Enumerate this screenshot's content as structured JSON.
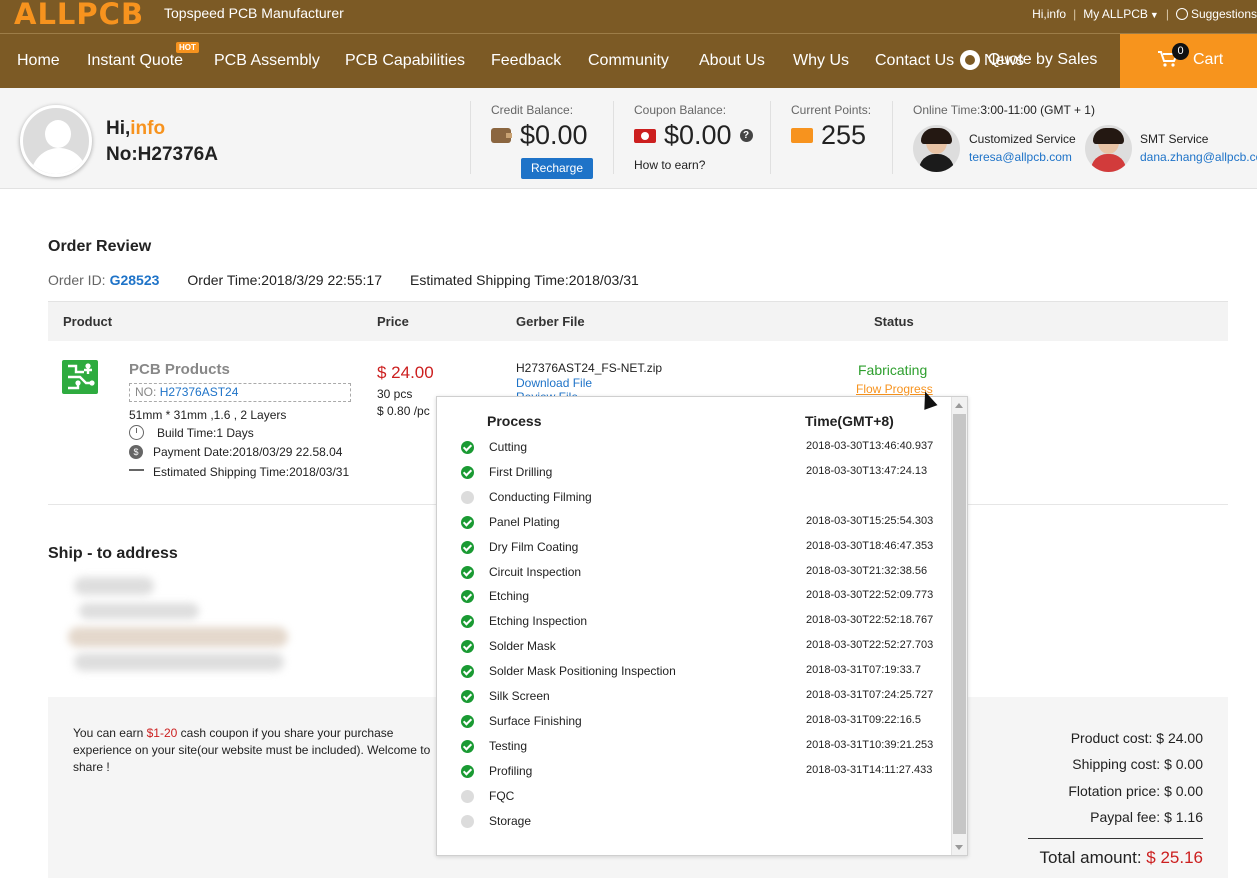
{
  "header": {
    "logo": "ALLPCB",
    "tagline": "Topspeed PCB Manufacturer",
    "greeting": "Hi,info",
    "my_account": "My ALLPCB",
    "suggestions": "Suggestions"
  },
  "nav": {
    "items": [
      "Home",
      "Instant Quote",
      "PCB Assembly",
      "PCB Capabilities",
      "Feedback",
      "Community",
      "About Us",
      "Why Us",
      "Contact Us",
      "News"
    ],
    "hot_badge": "HOT",
    "quote_by_sales": "Quote by Sales",
    "cart_count": "0",
    "cart_label": "Cart"
  },
  "account": {
    "hi_prefix": "Hi,",
    "hi_name": "info",
    "number": "No:H27376A",
    "credit_label": "Credit Balance:",
    "credit_value": "$0.00",
    "recharge": "Recharge",
    "coupon_label": "Coupon Balance:",
    "coupon_value": "$0.00",
    "how_to_earn": "How to earn?",
    "points_label": "Current Points:",
    "points_value": "255",
    "online_label": "Online Time:",
    "online_value": "3:00-11:00 (GMT + 1)",
    "reps": [
      {
        "title": "Customized Service",
        "email": "teresa@allpcb.com"
      },
      {
        "title": "SMT Service",
        "email": "dana.zhang@allpcb.com"
      }
    ]
  },
  "order": {
    "section_title": "Order Review",
    "id_label": "Order ID:",
    "id_value": "G28523",
    "order_time": "Order Time:2018/3/29 22:55:17",
    "est_shipping": "Estimated Shipping Time:2018/03/31",
    "columns": [
      "Product",
      "Price",
      "Gerber File",
      "Status"
    ],
    "product": {
      "name": "PCB Products",
      "no_label": "NO:",
      "no_value": "H27376AST24",
      "spec": "51mm * 31mm ,1.6 , 2 Layers",
      "build_time": "Build Time:1 Days",
      "payment_date": "Payment Date:2018/03/29 22.58.04",
      "shipping_time": "Estimated Shipping Time:2018/03/31"
    },
    "price": {
      "total": "$ 24.00",
      "qty": "30 pcs",
      "unit": "$ 0.80 /pc"
    },
    "gerber": {
      "file": "H27376AST24_FS-NET.zip",
      "download": "Download File",
      "review": "Review File"
    },
    "status": {
      "text": "Fabricating",
      "flow_link": "Flow Progress"
    }
  },
  "ship": {
    "title": "Ship - to address"
  },
  "summary": {
    "share_pre": "You can earn ",
    "share_amount": "$1-20",
    "share_post": " cash coupon if you share your purchase experience on your site(our website must be included). Welcome to share !",
    "product_cost": "Product cost: $ 24.00",
    "shipping_cost": "Shipping cost: $ 0.00",
    "flotation_price": "Flotation price: $ 0.00",
    "paypal_fee": "Paypal fee: $ 1.16",
    "total_label": "Total amount: ",
    "total_value": "$ 25.16"
  },
  "flow": {
    "col_process": "Process",
    "col_time": "Time(GMT+8)",
    "steps": [
      {
        "name": "Cutting",
        "time": "2018-03-30T13:46:40.937",
        "done": true
      },
      {
        "name": "First Drilling",
        "time": "2018-03-30T13:47:24.13",
        "done": true
      },
      {
        "name": "Conducting Filming",
        "time": "",
        "done": false
      },
      {
        "name": "Panel Plating",
        "time": "2018-03-30T15:25:54.303",
        "done": true
      },
      {
        "name": "Dry Film Coating",
        "time": "2018-03-30T18:46:47.353",
        "done": true
      },
      {
        "name": "Circuit Inspection",
        "time": "2018-03-30T21:32:38.56",
        "done": true
      },
      {
        "name": "Etching",
        "time": "2018-03-30T22:52:09.773",
        "done": true
      },
      {
        "name": "Etching Inspection",
        "time": "2018-03-30T22:52:18.767",
        "done": true
      },
      {
        "name": "Solder Mask",
        "time": "2018-03-30T22:52:27.703",
        "done": true
      },
      {
        "name": "Solder Mask Positioning Inspection",
        "time": "2018-03-31T07:19:33.7",
        "done": true
      },
      {
        "name": "Silk Screen",
        "time": "2018-03-31T07:24:25.727",
        "done": true
      },
      {
        "name": "Surface Finishing",
        "time": "2018-03-31T09:22:16.5",
        "done": true
      },
      {
        "name": "Testing",
        "time": "2018-03-31T10:39:21.253",
        "done": true
      },
      {
        "name": "Profiling",
        "time": "2018-03-31T14:11:27.433",
        "done": true
      },
      {
        "name": "FQC",
        "time": "",
        "done": false
      },
      {
        "name": "Storage",
        "time": "",
        "done": false
      }
    ]
  }
}
